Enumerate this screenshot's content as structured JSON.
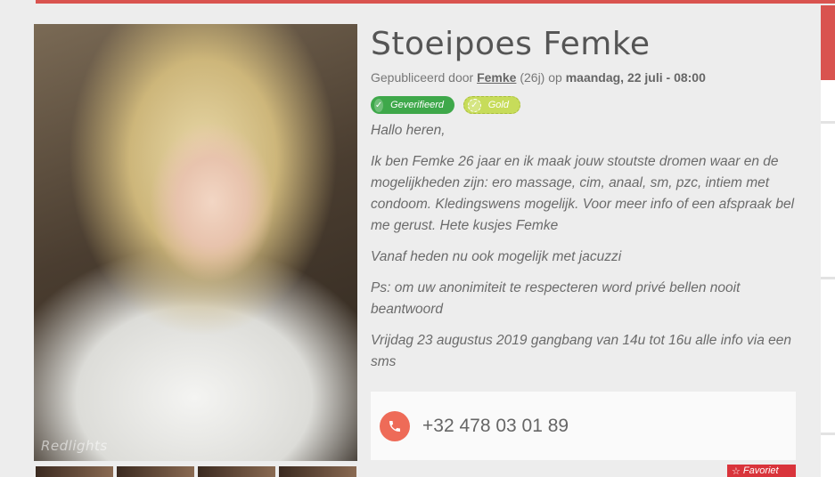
{
  "listing": {
    "title": "Stoeipoes Femke",
    "meta": {
      "prefix": "Gepubliceerd door",
      "author": "Femke",
      "age": "(26j)",
      "on": "op",
      "date": "maandag, 22 juli - 08:00"
    },
    "badges": {
      "verified": "Geverifieerd",
      "gold": "Gold"
    },
    "description": [
      "Hallo heren,",
      "Ik ben Femke 26 jaar en ik maak jouw stoutste dromen waar en de mogelijkheden zijn: ero massage, cim, anaal, sm, pzc, intiem met condoom. Kledingswens mogelijk. Voor meer info of een afspraak bel me gerust. Hete kusjes Femke",
      "Vanaf heden nu ook mogelijk met jacuzzi",
      "Ps: om uw anonimiteit te respecteren word privé bellen nooit beantwoord",
      "Vrijdag 23 augustus 2019 gangbang van 14u tot 16u alle info via een sms"
    ],
    "phone": "+32 478 03 01 89",
    "favorite_label": "Favoriet",
    "photo_watermark": "Redlights"
  },
  "icons": {
    "check": "check-icon",
    "phone": "phone-icon",
    "star": "star-icon"
  },
  "colors": {
    "accent_red": "#d9534f",
    "verified_green": "#3ea84a",
    "gold_lime": "#c7dc5a",
    "phone_coral": "#ee6b58",
    "favorite_red": "#d9343b"
  }
}
